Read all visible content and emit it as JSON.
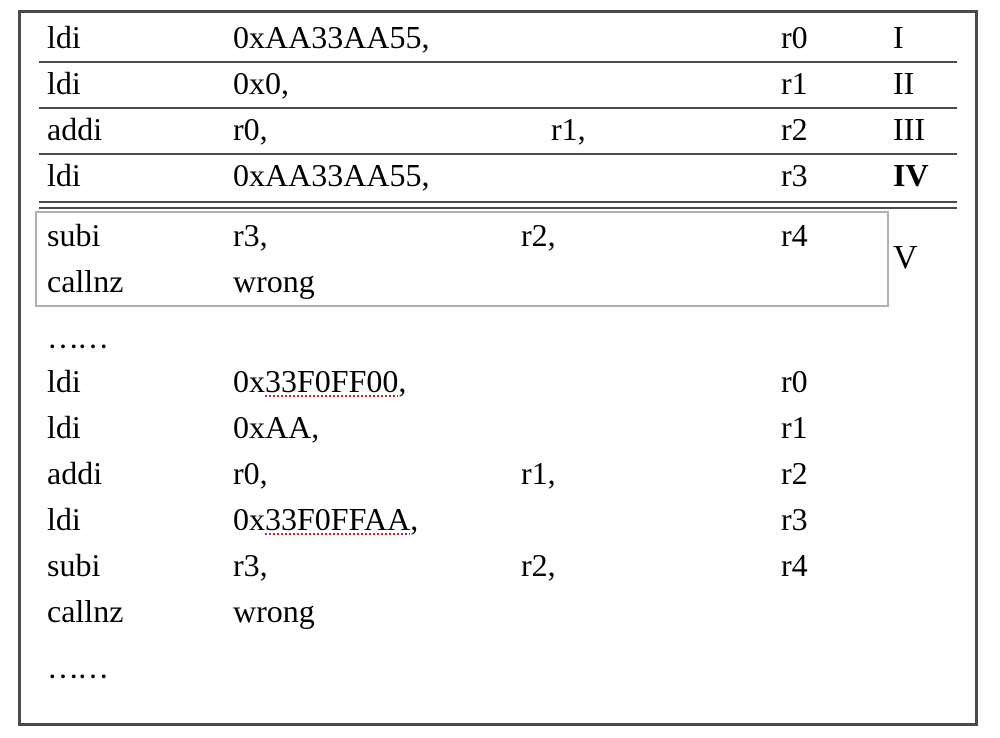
{
  "ellipsis": "……",
  "rows": [
    {
      "opcode": "ldi",
      "op1": "0xAA33AA55,",
      "op2": "",
      "op3": "r0",
      "label": "I"
    },
    {
      "opcode": "ldi",
      "op1": "0x0,",
      "op2": "",
      "op3": "r1",
      "label": "II"
    },
    {
      "opcode": "addi",
      "op1": "r0,",
      "op2": "r1,",
      "op3": "r2",
      "label": "III"
    },
    {
      "opcode": "ldi",
      "op1": "0xAA33AA55,",
      "op2": "",
      "op3": "r3",
      "label": "IV"
    },
    {
      "opcode": "subi",
      "op1": "r3,",
      "op2": "r2,",
      "op3": "r4",
      "label": "V"
    },
    {
      "opcode": "callnz",
      "op1": "wrong",
      "op2": "",
      "op3": "",
      "label": ""
    },
    {
      "opcode": "ldi",
      "op1_squig": "33F0FF00",
      "op3": "r0"
    },
    {
      "opcode": "ldi",
      "op1": "0xAA,",
      "op3": "r1"
    },
    {
      "opcode": "addi",
      "op1": "r0,",
      "op2": "r1,",
      "op3": "r2"
    },
    {
      "opcode": "ldi",
      "op1_squig": "33F0FFAA",
      "op3": "r3"
    },
    {
      "opcode": "subi",
      "op1": "r3,",
      "op2": "r2,",
      "op3": "r4"
    },
    {
      "opcode": "callnz",
      "op1": "wrong"
    }
  ]
}
